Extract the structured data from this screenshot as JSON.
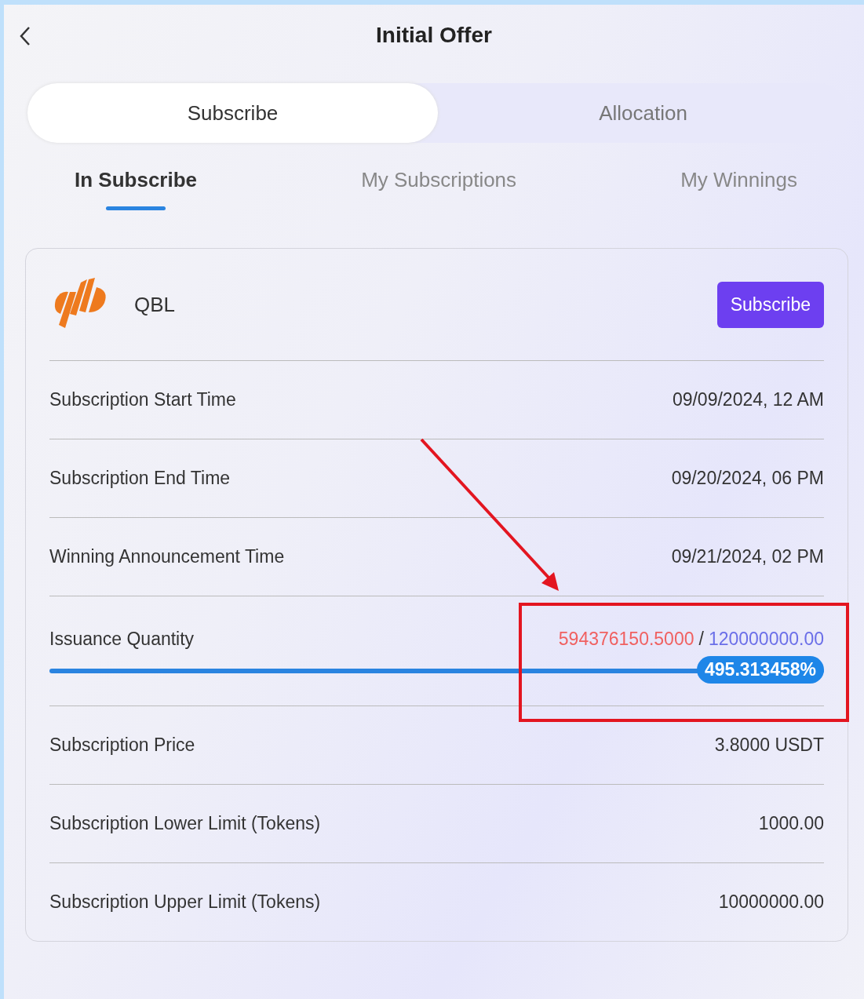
{
  "header": {
    "title": "Initial Offer"
  },
  "segments": [
    {
      "label": "Subscribe",
      "selected": true
    },
    {
      "label": "Allocation",
      "selected": false
    }
  ],
  "tabs": [
    {
      "label": "In Subscribe",
      "selected": true
    },
    {
      "label": "My Subscriptions",
      "selected": false
    },
    {
      "label": "My Winnings",
      "selected": false
    }
  ],
  "offer": {
    "name": "QBL",
    "button": "Subscribe",
    "rows": [
      {
        "kind": "text",
        "label": "Subscription Start Time",
        "value": "09/09/2024, 12 AM"
      },
      {
        "kind": "text",
        "label": "Subscription End Time",
        "value": "09/20/2024, 06 PM"
      },
      {
        "kind": "text",
        "label": "Winning Announcement Time",
        "value": "09/21/2024, 02 PM"
      },
      {
        "kind": "progress",
        "label": "Issuance Quantity",
        "subscribed": "594376150.5000",
        "separator": "/",
        "total": "120000000.00",
        "level": 1,
        "percent": "495.313458%"
      },
      {
        "kind": "text",
        "label": "Subscription Price",
        "value": "3.8000 USDT"
      },
      {
        "kind": "text",
        "label": "Subscription Lower Limit (Tokens)",
        "value": "1000.00"
      },
      {
        "kind": "text",
        "label": "Subscription Upper Limit (Tokens)",
        "value": "10000000.00"
      }
    ]
  }
}
